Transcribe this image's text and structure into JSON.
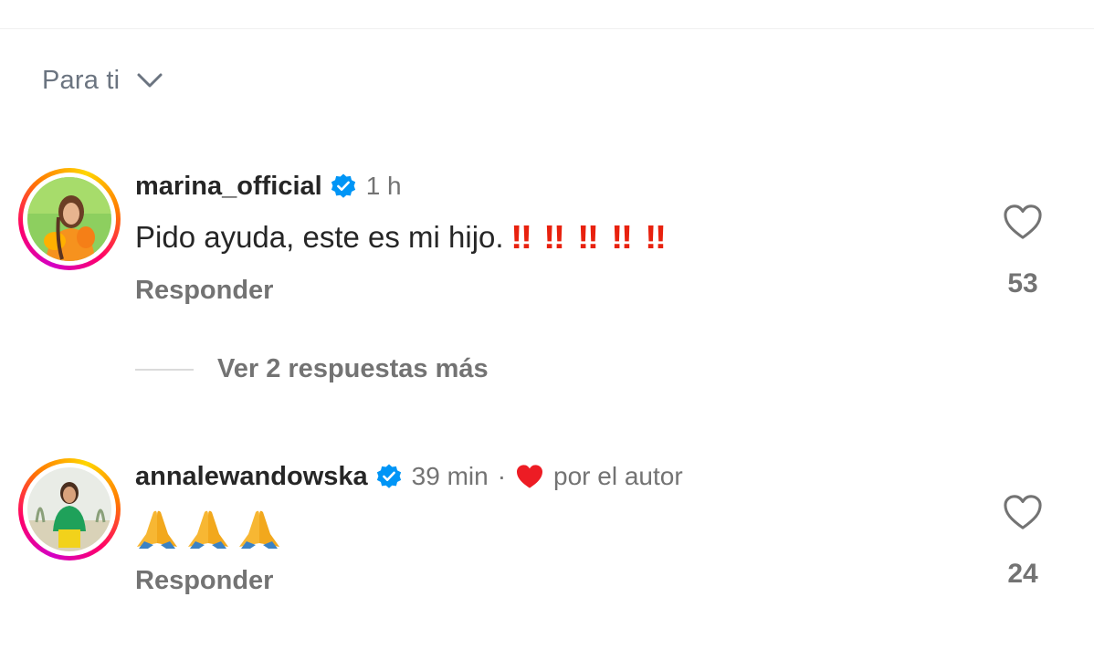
{
  "sort": {
    "label": "Para ti"
  },
  "comments": [
    {
      "username": "marina_official",
      "time": "1 h",
      "text": "Pido ayuda, este es mi hijo.",
      "emphasis": [
        "‼",
        "‼",
        "‼",
        "‼",
        "‼"
      ],
      "reply_label": "Responder",
      "likes": "53",
      "more_replies": "Ver 2 respuestas más"
    },
    {
      "username": "annalewandowska",
      "time": "39 min",
      "separator": "·",
      "author_tag": "por el autor",
      "emoji_text": "🙏🙏🙏",
      "reply_label": "Responder",
      "likes": "24"
    }
  ],
  "colors": {
    "accent_blue": "#0095f6",
    "heart_red": "#ed1c24",
    "exclaim_red": "#e8210e",
    "muted_text": "#737373"
  }
}
